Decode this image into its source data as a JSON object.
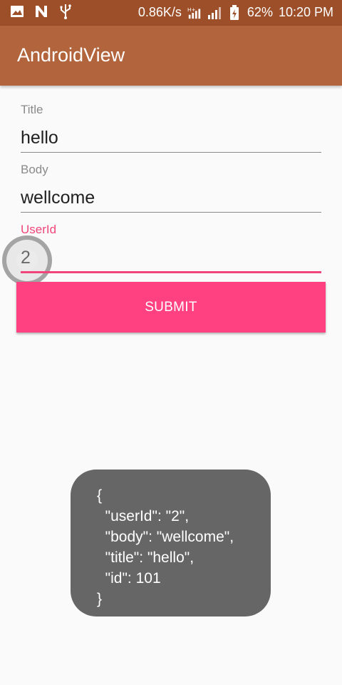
{
  "status_bar": {
    "speed": "0.86K/s",
    "battery": "62%",
    "time": "10:20 PM",
    "icons": [
      "image-icon",
      "n-icon",
      "usb-icon",
      "hplus-signal-icon",
      "signal-icon",
      "battery-icon"
    ]
  },
  "app_bar": {
    "title": "AndroidView"
  },
  "form": {
    "title_label": "Title",
    "title_value": "hello",
    "body_label": "Body",
    "body_value": "wellcome",
    "userid_label": "UserId",
    "userid_value": "2",
    "submit_label": "SUBMIT"
  },
  "toast": {
    "lines": [
      "{",
      "  \"userId\": \"2\",",
      "  \"body\": \"wellcome\",",
      "  \"title\": \"hello\",",
      "  \"id\": 101",
      "}"
    ]
  },
  "colors": {
    "status_bar": "#9c4f28",
    "app_bar": "#b2643c",
    "accent": "#ff4081",
    "toast_bg": "#666666"
  }
}
